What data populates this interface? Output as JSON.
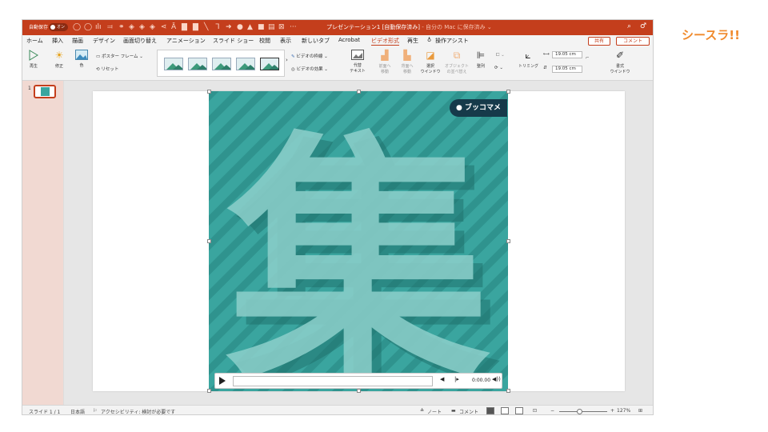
{
  "brand": {
    "logo": "シースラ!!"
  },
  "titlebar": {
    "autosave_label": "自動保存",
    "autosave_state": "オン",
    "title": "プレゼンテーション1 [自動保存済み]",
    "subtitle": " - 自分の Mac に保存済み ⌄",
    "search_icon": "search-icon",
    "share_icon": "share-icon"
  },
  "tabs": {
    "items": [
      "ホーム",
      "挿入",
      "描画",
      "デザイン",
      "画面切り替え",
      "アニメーション",
      "スライド ショー",
      "校閲",
      "表示",
      "新しいタブ",
      "Acrobat",
      "ビデオ形式",
      "再生",
      "操作アシスト"
    ],
    "active": "ビデオ形式",
    "share": "共有",
    "comment": "コメント"
  },
  "ribbon": {
    "play": "再生",
    "correct": "修正",
    "color": "色",
    "poster_frame": "ポスター フレーム ⌄",
    "reset": "リセット",
    "video_shape": "ビデオの枠線 ⌄",
    "video_effects": "ビデオの効果 ⌄",
    "alt_text": [
      "代替",
      "テキスト"
    ],
    "bring_forward": [
      "前面へ",
      "移動"
    ],
    "send_backward": [
      "背面へ",
      "移動"
    ],
    "selection_pane": [
      "選択",
      "ウインドウ"
    ],
    "reorder": [
      "オブジェクト",
      "の並べ替え"
    ],
    "align": "整列",
    "trim": "トリミング",
    "height": "19.05 cm",
    "width": "19.05 cm",
    "format_pane": [
      "書式",
      "ウインドウ"
    ]
  },
  "thumbs": {
    "slide_number": "1"
  },
  "video": {
    "badge": "● ブッコマメ",
    "kanji": "集",
    "time": "0:00.00",
    "colors": {
      "bg": "#3aa59f",
      "stripe": "#2e8f8a",
      "glyph": "#8dd0cb"
    }
  },
  "status": {
    "slide": "スライド 1 / 1",
    "lang": "日本語",
    "accessibility": "アクセシビリティ: 検討が必要です",
    "notes": "ノート",
    "comments": "コメント",
    "zoom": "127%"
  }
}
